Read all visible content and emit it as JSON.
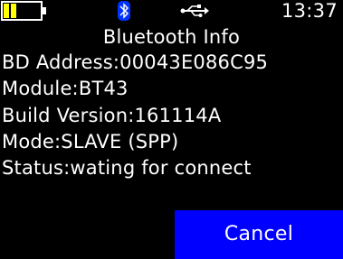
{
  "status_bar": {
    "battery_icon": "battery-low-icon",
    "battery_fill_color": "#ffff00",
    "bluetooth_icon": "bluetooth-icon",
    "bluetooth_color": "#0033ff",
    "usb_icon": "usb-icon",
    "time": "13:37"
  },
  "page": {
    "title": "Bluetooth Info"
  },
  "info": {
    "bd_address": "BD Address:00043E086C95",
    "module": "Module:BT43",
    "build_version": "Build Version:161114A",
    "mode": "Mode:SLAVE (SPP)",
    "status": "Status:wating for connect"
  },
  "actions": {
    "cancel_label": "Cancel",
    "cancel_color": "#0000ff"
  }
}
